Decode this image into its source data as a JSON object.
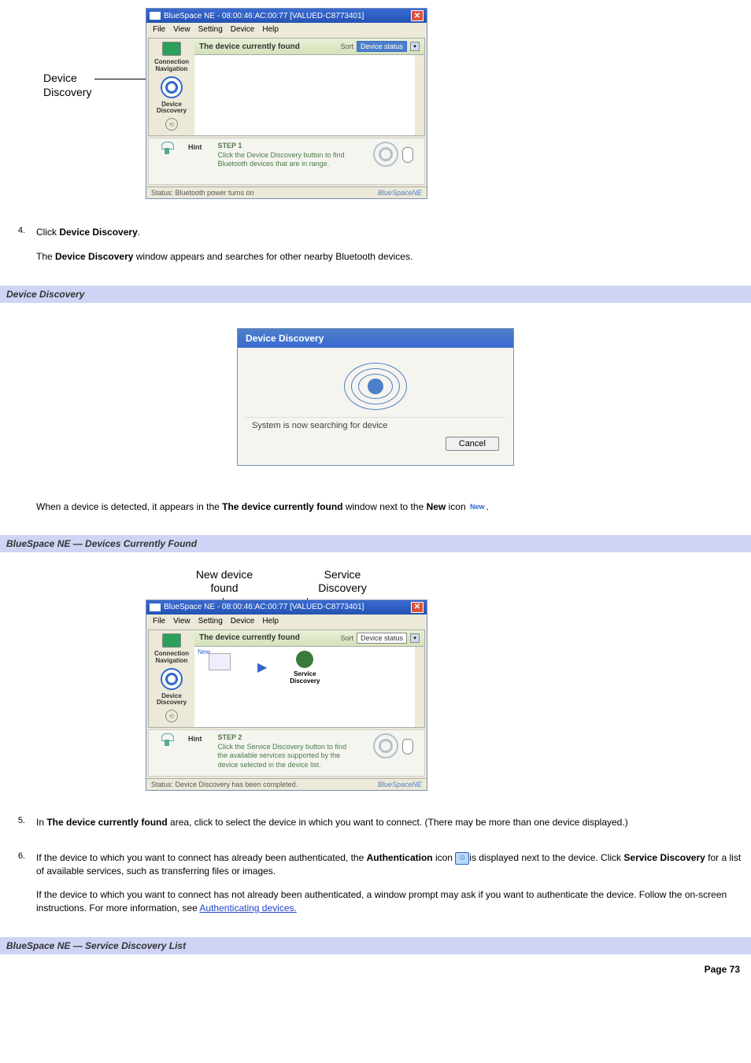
{
  "fig1": {
    "callout_label": "Device\nDiscovery",
    "title": "BlueSpace NE - 08:00:46:AC:00:77 [VALUED-C8773401]",
    "menu": {
      "file": "File",
      "view": "View",
      "setting": "Setting",
      "device": "Device",
      "help": "Help"
    },
    "sidebar": {
      "conn_nav": "Connection\nNavigation",
      "dev_disc": "Device\nDiscovery"
    },
    "header_title": "The device currently found",
    "sort_label": "Sort",
    "sort_value": "Device status",
    "hint_label": "Hint",
    "step_hdr": "STEP 1",
    "hint_text": "Click the Device Discovery button to find Bluetooth devices that are in range.",
    "status": "Status: Bluetooth power turns on",
    "brand": "BlueSpaceNE"
  },
  "step4": {
    "num": "4.",
    "line1_a": "Click ",
    "line1_b": "Device Discovery",
    "line1_c": ".",
    "line2_a": "The ",
    "line2_b": "Device Discovery",
    "line2_c": " window appears and searches for other nearby Bluetooth devices."
  },
  "section1": "Device Discovery",
  "fig2": {
    "title": "Device Discovery",
    "msg": "System is now searching for device",
    "cancel": "Cancel"
  },
  "midpara": {
    "a": "When a device is detected, it appears in the ",
    "b": "The device currently found",
    "c": " window next to the ",
    "d": "New",
    "e": " icon ",
    "new_icon": "New",
    "f": "."
  },
  "section2": "BlueSpace NE — Devices Currently Found",
  "fig3": {
    "callout1": "New device\nfound",
    "callout2": "Service\nDiscovery",
    "title": "BlueSpace NE - 08:00:46:AC:00:77 [VALUED-C8773401]",
    "menu": {
      "file": "File",
      "view": "View",
      "setting": "Setting",
      "device": "Device",
      "help": "Help"
    },
    "sidebar": {
      "conn_nav": "Connection\nNavigation",
      "dev_disc": "Device\nDiscovery"
    },
    "header_title": "The device currently found",
    "sort_label": "Sort",
    "sort_value": "Device status",
    "new_tag": "New",
    "service_label": "Service\nDiscovery",
    "hint_label": "Hint",
    "step_hdr": "STEP 2",
    "hint_text": "Click the Service Discovery button to find the available services supported by the device selected in the device list.",
    "status": "Status: Device Discovery has been completed.",
    "brand": "BlueSpaceNE"
  },
  "step5": {
    "num": "5.",
    "a": "In ",
    "b": "The device currently found",
    "c": " area, click to select the device in which you want to connect. (There may be more than one device displayed.)"
  },
  "step6": {
    "num": "6.",
    "p1a": "If the device to which you want to connect has already been authenticated, the ",
    "p1b": "Authentication",
    "p1c": " icon ",
    "auth_glyph": "☺",
    "p1d": "is displayed next to the device. Click ",
    "p1e": "Service Discovery",
    "p1f": " for a list of available services, such as transferring files or images.",
    "p2a": "If the device to which you want to connect has not already been authenticated, a window prompt may ask if you want to authenticate the device. Follow the on-screen instructions. For more information, see ",
    "p2link": "Authenticating devices."
  },
  "section3": "BlueSpace NE — Service Discovery List",
  "footer": "Page 73"
}
